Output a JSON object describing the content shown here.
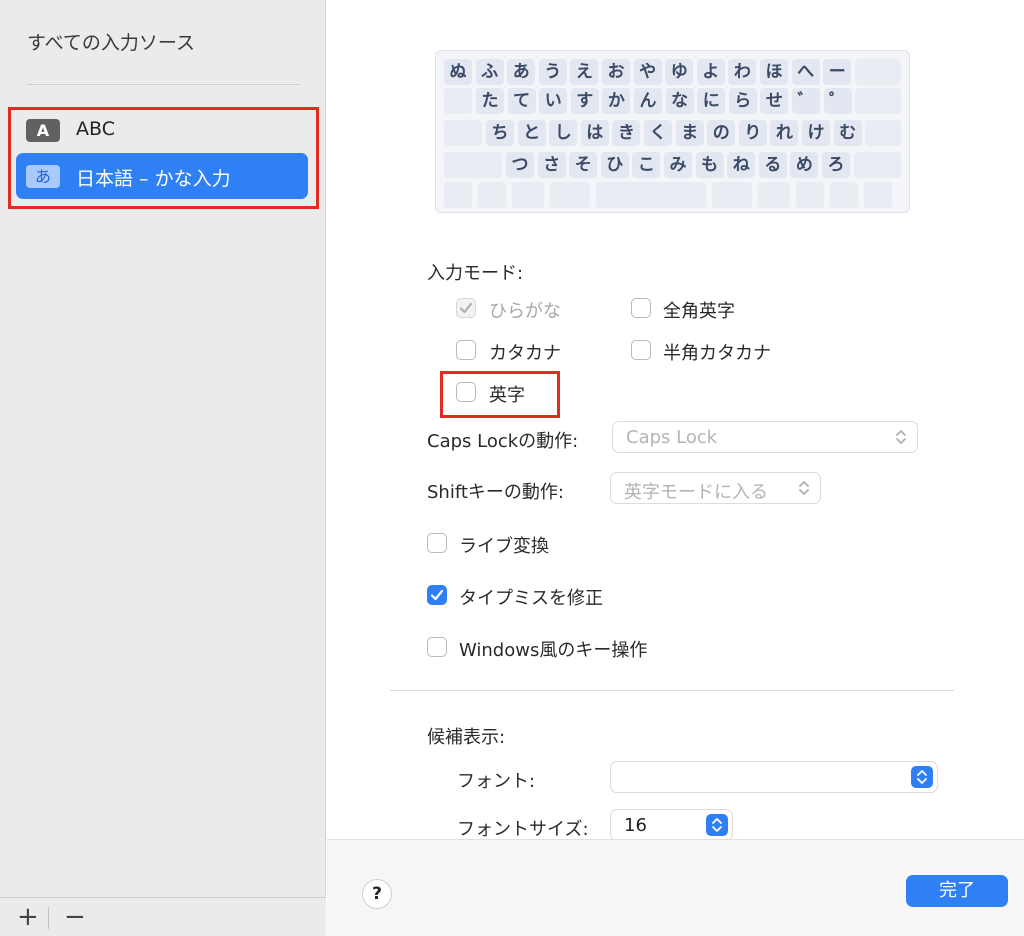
{
  "colors": {
    "accent": "#2f7ff5",
    "highlight_box": "#e32a22",
    "sidebar_bg": "#ebebeb"
  },
  "sidebar": {
    "title": "すべての入力ソース",
    "items": [
      {
        "badge": "A",
        "label": "ABC",
        "selected": false
      },
      {
        "badge": "あ",
        "label": "日本語 – かな入力",
        "selected": true
      }
    ],
    "add_label": "+",
    "remove_label": "−"
  },
  "keyboard": {
    "rows": [
      [
        "ぬ",
        "ふ",
        "あ",
        "う",
        "え",
        "お",
        "や",
        "ゆ",
        "よ",
        "わ",
        "ほ",
        "へ",
        "ー"
      ],
      [
        "た",
        "て",
        "い",
        "す",
        "か",
        "ん",
        "な",
        "に",
        "ら",
        "せ",
        "゛",
        "゜"
      ],
      [
        "ち",
        "と",
        "し",
        "は",
        "き",
        "く",
        "ま",
        "の",
        "り",
        "れ",
        "け",
        "む"
      ],
      [
        "つ",
        "さ",
        "そ",
        "ひ",
        "こ",
        "み",
        "も",
        "ね",
        "る",
        "め",
        "ろ"
      ]
    ]
  },
  "input_mode": {
    "heading": "入力モード:",
    "options": [
      {
        "label": "ひらがな",
        "checked": true,
        "disabled": true
      },
      {
        "label": "全角英字",
        "checked": false,
        "disabled": false
      },
      {
        "label": "カタカナ",
        "checked": false,
        "disabled": false
      },
      {
        "label": "半角カタカナ",
        "checked": false,
        "disabled": false
      },
      {
        "label": "英字",
        "checked": false,
        "disabled": false
      }
    ]
  },
  "caps_lock": {
    "label": "Caps Lockの動作:",
    "value": "Caps Lock"
  },
  "shift_key": {
    "label": "Shiftキーの動作:",
    "value": "英字モードに入る"
  },
  "options": [
    {
      "label": "ライブ変換",
      "checked": false
    },
    {
      "label": "タイプミスを修正",
      "checked": true
    },
    {
      "label": "Windows風のキー操作",
      "checked": false
    }
  ],
  "candidates": {
    "heading": "候補表示:",
    "font_label": "フォント:",
    "font_value": "",
    "font_size_label": "フォントサイズ:",
    "font_size_value": "16"
  },
  "footer": {
    "help_label": "?",
    "done_label": "完了"
  }
}
